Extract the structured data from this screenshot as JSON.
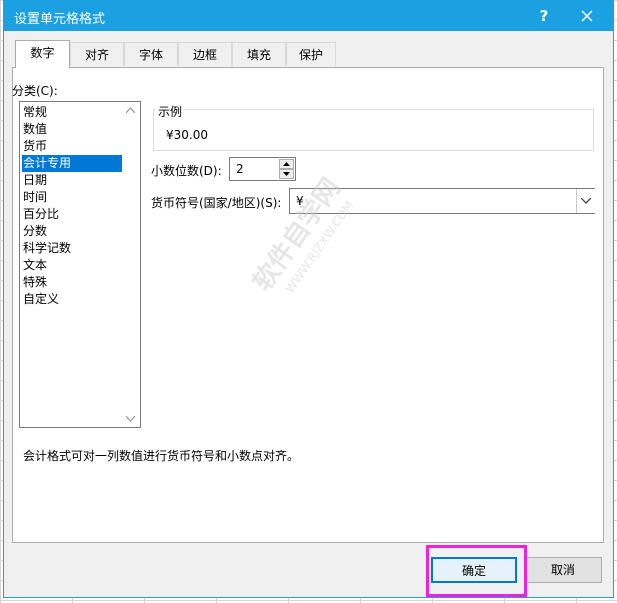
{
  "dialog": {
    "title": "设置单元格格式",
    "help_label": "?",
    "tabs": [
      "数字",
      "对齐",
      "字体",
      "边框",
      "填充",
      "保护"
    ],
    "active_tab": "数字"
  },
  "category": {
    "label": "分类(C):",
    "items": [
      "常规",
      "数值",
      "货币",
      "会计专用",
      "日期",
      "时间",
      "百分比",
      "分数",
      "科学记数",
      "文本",
      "特殊",
      "自定义"
    ],
    "selected": "会计专用"
  },
  "sample": {
    "label": "示例",
    "value": "¥30.00"
  },
  "decimals": {
    "label": "小数位数(D):",
    "value": "2"
  },
  "currency": {
    "label": "货币符号(国家/地区)(S):",
    "value": "¥"
  },
  "description": "会计格式可对一列数值进行货币符号和小数点对齐。",
  "buttons": {
    "ok": "确定",
    "cancel": "取消"
  },
  "watermark": {
    "text": "软件自学网",
    "sub": "WWW.RJZXW.COM"
  },
  "colors": {
    "titlebar": "#1ba1e2",
    "selection": "#0078d7",
    "highlight": "#ee22dd"
  }
}
